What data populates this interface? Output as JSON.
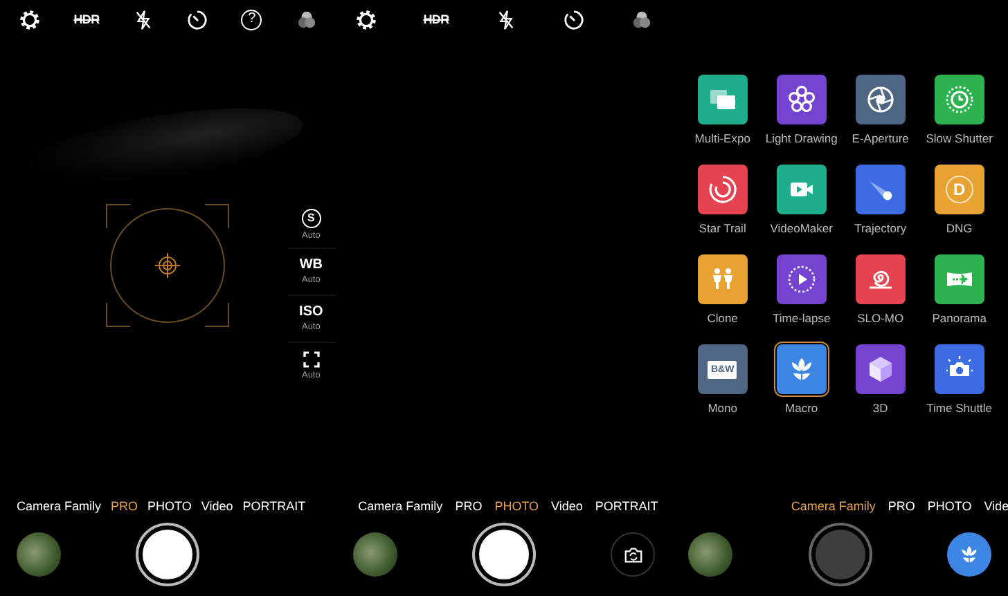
{
  "panels": [
    {
      "kind": "pro",
      "toolbar": [
        {
          "kind": "settings"
        },
        {
          "kind": "hdr",
          "label": "HDR"
        },
        {
          "kind": "flash-off"
        },
        {
          "kind": "timer"
        },
        {
          "kind": "help",
          "label": "?"
        },
        {
          "kind": "filter"
        }
      ],
      "pro_controls": [
        {
          "kind": "circled",
          "label": "S",
          "value": "Auto"
        },
        {
          "kind": "text",
          "label": "WB",
          "value": "Auto"
        },
        {
          "kind": "text",
          "label": "ISO",
          "value": "Auto"
        },
        {
          "kind": "focus-frame",
          "value": "Auto"
        }
      ],
      "modes": [
        {
          "label": "Camera Family",
          "selected": false
        },
        {
          "label": "PRO",
          "selected": true
        },
        {
          "label": "PHOTO",
          "selected": false
        },
        {
          "label": "Video",
          "selected": false
        },
        {
          "label": "PORTRAIT",
          "selected": false
        }
      ],
      "shutter": {
        "disabled": false
      }
    },
    {
      "kind": "photo",
      "toolbar": [
        {
          "kind": "settings"
        },
        {
          "kind": "hdr",
          "label": "HDR"
        },
        {
          "kind": "flash-off"
        },
        {
          "kind": "timer"
        },
        {
          "kind": "filter"
        }
      ],
      "modes": [
        {
          "label": "Camera Family",
          "selected": false
        },
        {
          "label": "PRO",
          "selected": false
        },
        {
          "label": "PHOTO",
          "selected": true
        },
        {
          "label": "Video",
          "selected": false
        },
        {
          "label": "PORTRAIT",
          "selected": false
        }
      ],
      "shutter": {
        "disabled": false
      },
      "side_button": {
        "kind": "switch-camera"
      }
    },
    {
      "kind": "camera-family",
      "tiles": [
        {
          "label": "Multi-Expo",
          "color": "#1fae8c",
          "kind": "glyph",
          "selected": false
        },
        {
          "label": "Light Drawing",
          "color": "#7443d0",
          "kind": "glyph",
          "selected": false
        },
        {
          "label": "E-Aperture",
          "color": "#4f6784",
          "kind": "glyph",
          "selected": false
        },
        {
          "label": "Slow Shutter",
          "color": "#2eb24f",
          "kind": "glyph",
          "selected": false
        },
        {
          "label": "Star Trail",
          "color": "#e5434f",
          "kind": "glyph",
          "selected": false
        },
        {
          "label": "VideoMaker",
          "color": "#1fae8c",
          "kind": "glyph",
          "selected": false
        },
        {
          "label": "Trajectory",
          "color": "#3d6be3",
          "kind": "glyph",
          "selected": false
        },
        {
          "label": "DNG",
          "color": "#e8a232",
          "kind": "circle-letter",
          "icon_text": "D",
          "selected": false
        },
        {
          "label": "Clone",
          "color": "#e8a232",
          "kind": "glyph",
          "selected": false
        },
        {
          "label": "Time-lapse",
          "color": "#7443d0",
          "kind": "glyph",
          "selected": false
        },
        {
          "label": "SLO-MO",
          "color": "#e5434f",
          "kind": "glyph",
          "selected": false
        },
        {
          "label": "Panorama",
          "color": "#2eb24f",
          "kind": "glyph",
          "selected": false
        },
        {
          "label": "Mono",
          "color": "#4f6784",
          "kind": "plate-label",
          "icon_text": "B&W",
          "selected": false
        },
        {
          "label": "Macro",
          "color": "#3d86e3",
          "kind": "glyph",
          "selected": true
        },
        {
          "label": "3D",
          "color": "#7443d0",
          "kind": "glyph",
          "selected": false
        },
        {
          "label": "Time Shuttle",
          "color": "#3d6be3",
          "kind": "glyph",
          "selected": false
        }
      ],
      "modes": [
        {
          "label": "Camera Family",
          "selected": true
        },
        {
          "label": "PRO",
          "selected": false
        },
        {
          "label": "PHOTO",
          "selected": false
        },
        {
          "label": "Vide",
          "selected": false
        }
      ],
      "shutter": {
        "disabled": true
      },
      "side_button": {
        "kind": "macro"
      }
    }
  ]
}
